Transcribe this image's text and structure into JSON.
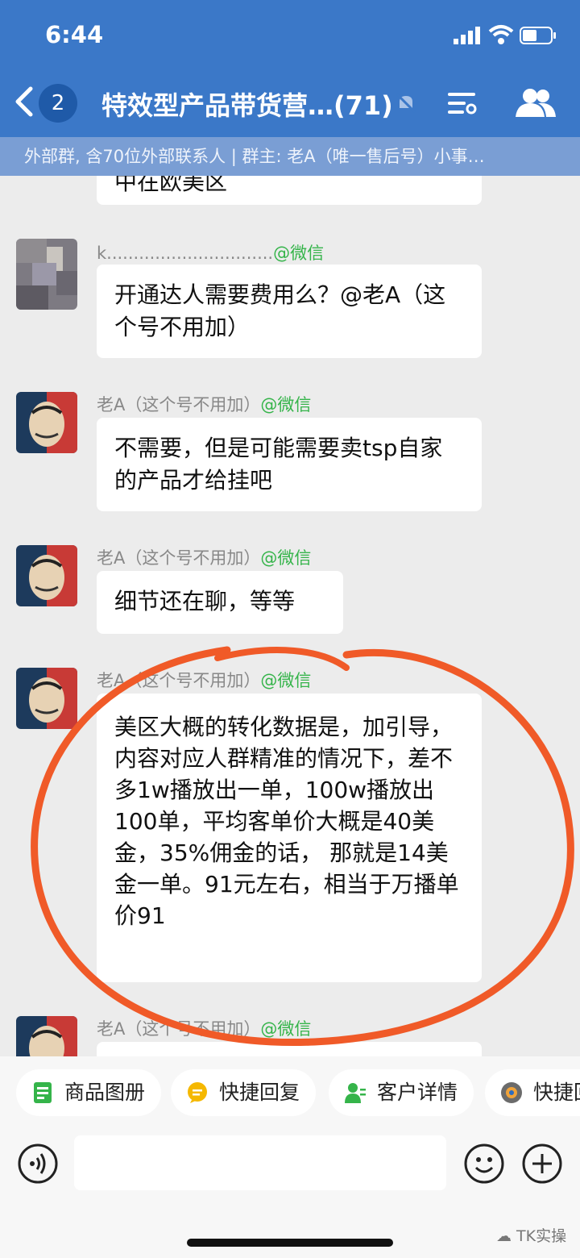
{
  "status": {
    "time": "6:44"
  },
  "header": {
    "unread_count": "2",
    "title": "特效型产品带货营…(71)",
    "subtitle": "外部群, 含70位外部联系人 | 群主: 老A（唯一售后号）小事…"
  },
  "messages": [
    {
      "sender": "",
      "sender_tag": "",
      "text": "中在欧美区",
      "partial": true
    },
    {
      "sender": "k...............................",
      "sender_tag": "@微信",
      "text": "开通达人需要费用么？@老A（这个号不用加）"
    },
    {
      "sender": "老A（这个号不用加）",
      "sender_tag": "@微信",
      "text": "不需要，但是可能需要卖tsp自家的产品才给挂吧"
    },
    {
      "sender": "老A（这个号不用加）",
      "sender_tag": "@微信",
      "text": "细节还在聊，等等"
    },
    {
      "sender": "老A（这个号不用加）",
      "sender_tag": "@微信",
      "text": "美区大概的转化数据是，加引导，内容对应人群精准的情况下，差不多1w播放出一单，100w播放出100单，平均客单价大概是40美金，35%佣金的话， 那就是14美金一单。91元左右，相当于万播单价91"
    },
    {
      "sender": "老A（这个号不用加）",
      "sender_tag": "@微信",
      "text": ""
    }
  ],
  "quick_actions": [
    "商品图册",
    "快捷回复",
    "客户详情",
    "快捷回"
  ],
  "input": {
    "placeholder": ""
  },
  "watermark": "TK实操",
  "colors": {
    "header": "#3b78c8",
    "subheader": "#7a9ed4",
    "accent_green": "#35b44a",
    "annotation_red": "#f05a28"
  }
}
